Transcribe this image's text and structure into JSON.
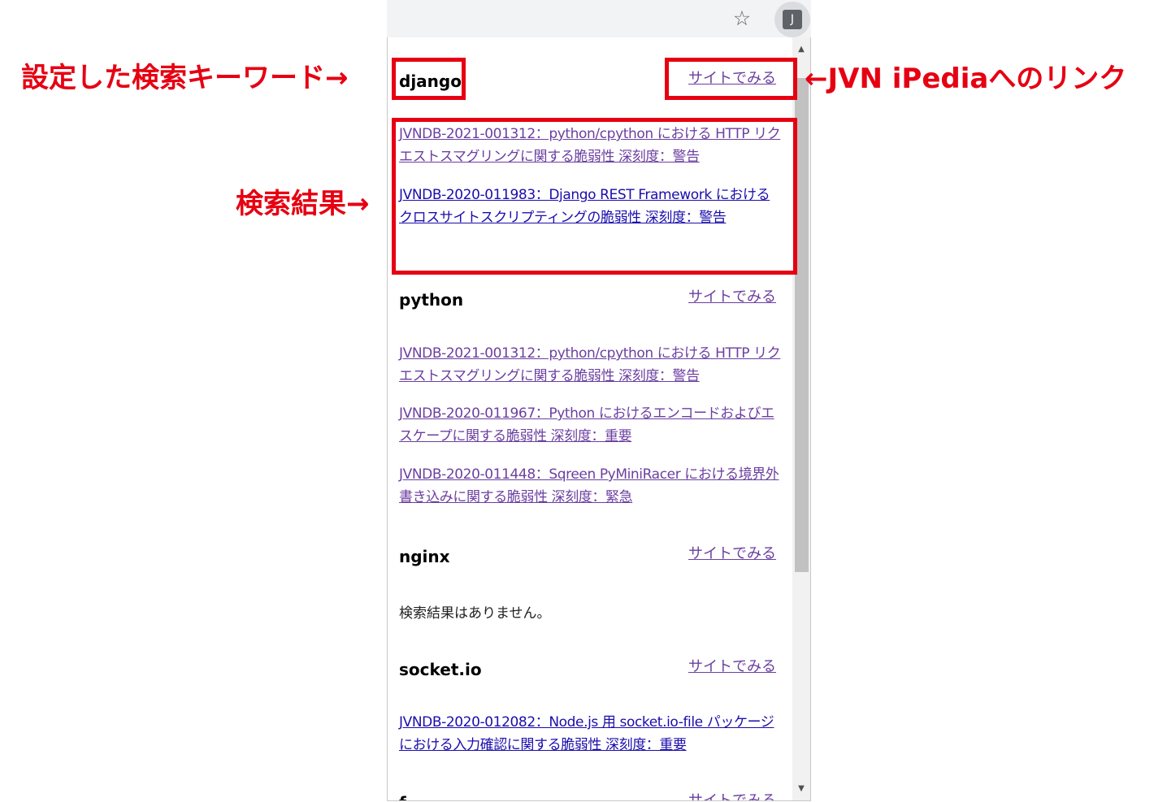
{
  "browser": {
    "bookmark_icon": "star-icon",
    "extension_icon_letter": "J"
  },
  "popup": {
    "sections": [
      {
        "keyword": "django",
        "site_link": "サイトでみる",
        "results": [
          {
            "text": "JVNDB-2021-001312：python/cpython における HTTP リクエストスマグリングに関する脆弱性 深刻度：警告",
            "visited": true
          },
          {
            "text": "JVNDB-2020-011983：Django REST Framework におけるクロスサイトスクリプティングの脆弱性 深刻度：警告",
            "visited": false
          }
        ]
      },
      {
        "keyword": "python",
        "site_link": "サイトでみる",
        "results": [
          {
            "text": "JVNDB-2021-001312：python/cpython における HTTP リクエストスマグリングに関する脆弱性 深刻度：警告",
            "visited": true
          },
          {
            "text": "JVNDB-2020-011967：Python におけるエンコードおよびエスケープに関する脆弱性 深刻度：重要",
            "visited": true
          },
          {
            "text": "JVNDB-2020-011448：Sqreen PyMiniRacer における境界外書き込みに関する脆弱性 深刻度：緊急",
            "visited": true
          }
        ]
      },
      {
        "keyword": "nginx",
        "site_link": "サイトでみる",
        "no_results": "検索結果はありません。"
      },
      {
        "keyword": "socket.io",
        "site_link": "サイトでみる",
        "results": [
          {
            "text": "JVNDB-2020-012082：Node.js 用 socket.io-file パッケージにおける入力確認に関する脆弱性 深刻度：重要",
            "visited": false
          }
        ]
      },
      {
        "keyword": "f",
        "site_link": "サイトでみる"
      }
    ]
  },
  "annotations": {
    "keyword_label": "設定した検索キーワード→",
    "link_label": "←JVN iPediaへのリンク",
    "results_label": "検索結果→",
    "color": "#e60012"
  }
}
